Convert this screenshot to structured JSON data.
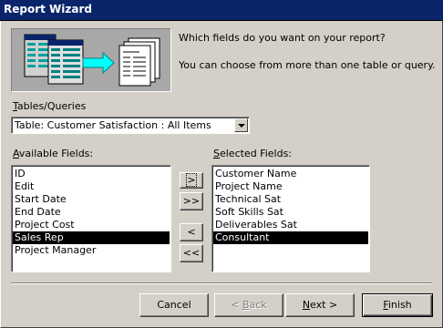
{
  "window": {
    "title": "Report Wizard"
  },
  "prompt": {
    "question": "Which fields do you want on your report?",
    "hint": "You can choose from more than one table or query."
  },
  "tables_queries": {
    "label_hotkey": "T",
    "label_rest": "ables/Queries",
    "selected_value": "Table: Customer Satisfaction : All Items"
  },
  "available_fields": {
    "label_hotkey": "A",
    "label_rest": "vailable Fields:",
    "items": [
      "ID",
      "Edit",
      "Start Date",
      "End Date",
      "Project Cost",
      "Sales Rep",
      "Project Manager"
    ],
    "selected": "Sales Rep"
  },
  "selected_fields": {
    "label_pre": "",
    "label_hotkey": "S",
    "label_rest": "elected Fields:",
    "items": [
      "Customer Name",
      "Project Name",
      "Technical Sat",
      "Soft Skills Sat",
      "Deliverables Sat",
      "Consultant"
    ],
    "selected": "Consultant"
  },
  "move_buttons": {
    "add_one": ">",
    "add_all": ">>",
    "remove_one": "<",
    "remove_all": "<<"
  },
  "footer": {
    "cancel": "Cancel",
    "back_hotkey": "B",
    "back_pre": "< ",
    "back_rest": "ack",
    "next_hotkey": "N",
    "next_rest": "ext >",
    "finish_hotkey": "F",
    "finish_rest": "inish"
  },
  "colors": {
    "titlebar": "#0a246a",
    "dialog_face": "#d4d0c8",
    "selection": "#000000",
    "arrow": "#00ffff"
  }
}
